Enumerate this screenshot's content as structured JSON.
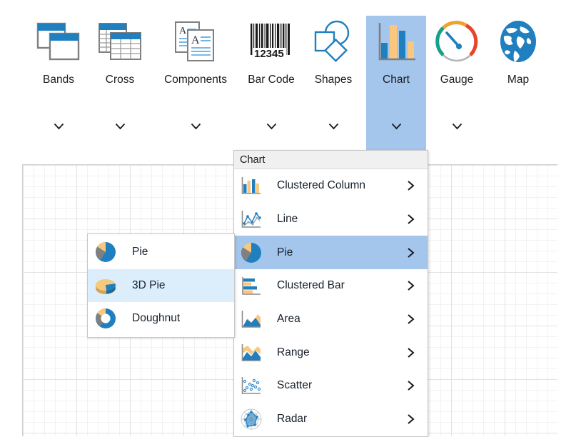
{
  "toolbar": {
    "items": [
      {
        "label": "Bands",
        "icon": "bands-icon",
        "has_dropdown": true,
        "selected": false
      },
      {
        "label": "Cross",
        "icon": "cross-icon",
        "has_dropdown": true,
        "selected": false
      },
      {
        "label": "Components",
        "icon": "components-icon",
        "has_dropdown": true,
        "selected": false
      },
      {
        "label": "Bar Code",
        "icon": "barcode-icon",
        "has_dropdown": true,
        "selected": false
      },
      {
        "label": "Shapes",
        "icon": "shapes-icon",
        "has_dropdown": true,
        "selected": false
      },
      {
        "label": "Chart",
        "icon": "chart-icon",
        "has_dropdown": true,
        "selected": true
      },
      {
        "label": "Gauge",
        "icon": "gauge-icon",
        "has_dropdown": true,
        "selected": false
      },
      {
        "label": "Map",
        "icon": "map-icon",
        "has_dropdown": false,
        "selected": false
      }
    ],
    "barcode_digits": "12345"
  },
  "chart_menu": {
    "header": "Chart",
    "items": [
      {
        "label": "Clustered Column",
        "icon": "clustered-column-icon",
        "highlighted": false,
        "arrow": "chevron-right-icon"
      },
      {
        "label": "Line",
        "icon": "line-chart-icon",
        "highlighted": false,
        "arrow": "chevron-right-icon"
      },
      {
        "label": "Pie",
        "icon": "pie-chart-icon",
        "highlighted": true,
        "arrow": "chevron-right-icon"
      },
      {
        "label": "Clustered Bar",
        "icon": "clustered-bar-icon",
        "highlighted": false,
        "arrow": "chevron-right-icon"
      },
      {
        "label": "Area",
        "icon": "area-chart-icon",
        "highlighted": false,
        "arrow": "chevron-right-icon"
      },
      {
        "label": "Range",
        "icon": "range-chart-icon",
        "highlighted": false,
        "arrow": "chevron-right-icon"
      },
      {
        "label": "Scatter",
        "icon": "scatter-chart-icon",
        "highlighted": false,
        "arrow": "chevron-right-icon"
      },
      {
        "label": "Radar",
        "icon": "radar-chart-icon",
        "highlighted": false,
        "arrow": "chevron-right-icon"
      }
    ]
  },
  "pie_submenu": {
    "items": [
      {
        "label": "Pie",
        "icon": "pie-icon",
        "highlighted": false
      },
      {
        "label": "3D Pie",
        "icon": "pie-3d-icon",
        "highlighted": true
      },
      {
        "label": "Doughnut",
        "icon": "doughnut-icon",
        "highlighted": false
      }
    ]
  },
  "colors": {
    "accent_blue": "#1f7fbf",
    "selection_blue": "#a4c6ed",
    "submenu_highlight": "#dceefc",
    "chart_orange": "#fac77e",
    "chart_gray": "#808080",
    "menu_header_bg": "#f0f0f0",
    "grid_line": "#e2e2e2"
  }
}
